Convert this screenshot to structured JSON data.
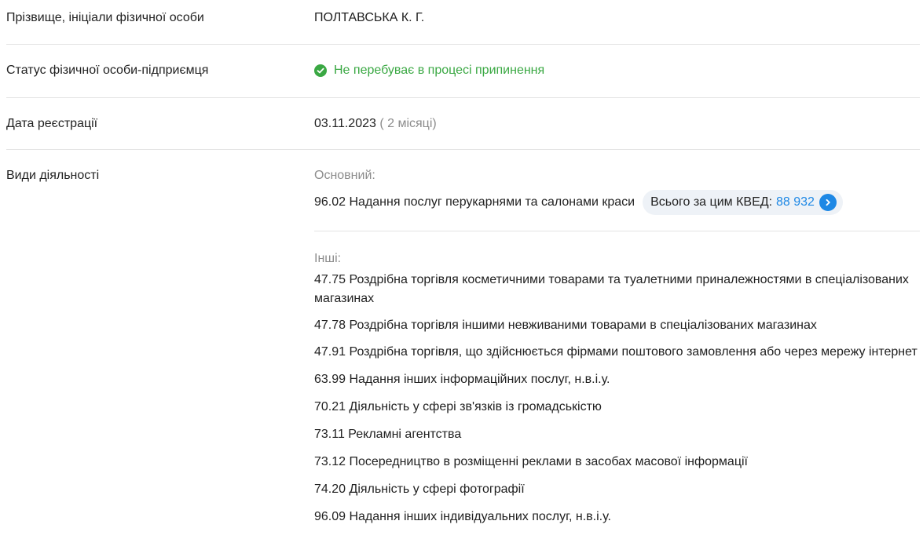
{
  "name_row": {
    "label": "Прізвище, ініціали фізичної особи",
    "value": "ПОЛТАВСЬКА К. Г."
  },
  "status_row": {
    "label": "Статус фізичної особи-підприємця",
    "value": "Не перебуває в процесі припинення",
    "icon": "check-circle-icon",
    "color": "#3aa843"
  },
  "date_row": {
    "label": "Дата реєстрації",
    "value": "03.11.2023",
    "note": "( 2 місяці)"
  },
  "activities_row": {
    "label": "Види діяльності",
    "primary_heading": "Основний:",
    "primary": "96.02 Надання послуг перукарнями та салонами краси",
    "kved_total_label": "Всього за цим КВЕД:",
    "kved_total_value": "88 932",
    "others_heading": "Інші:",
    "others": [
      "47.75 Роздрібна торгівля косметичними товарами та туалетними приналежностями в спеціалізованих магазинах",
      "47.78 Роздрібна торгівля іншими невживаними товарами в спеціалізованих магазинах",
      "47.91 Роздрібна торгівля, що здійснюється фірмами поштового замовлення або через мережу інтернет",
      "63.99 Надання інших інформаційних послуг, н.в.і.у.",
      "70.21 Діяльність у сфері зв'язків із громадськістю",
      "73.11 Рекламні агентства",
      "73.12 Посередництво в розміщенні реклами в засобах масової інформації",
      "74.20 Діяльність у сфері фотографії",
      "96.09 Надання інших індивідуальних послуг, н.в.і.у."
    ]
  },
  "colors": {
    "accent": "#1e88e5",
    "success": "#3aa843",
    "muted": "#8c8c8c",
    "pill_bg": "#eef2f7"
  }
}
